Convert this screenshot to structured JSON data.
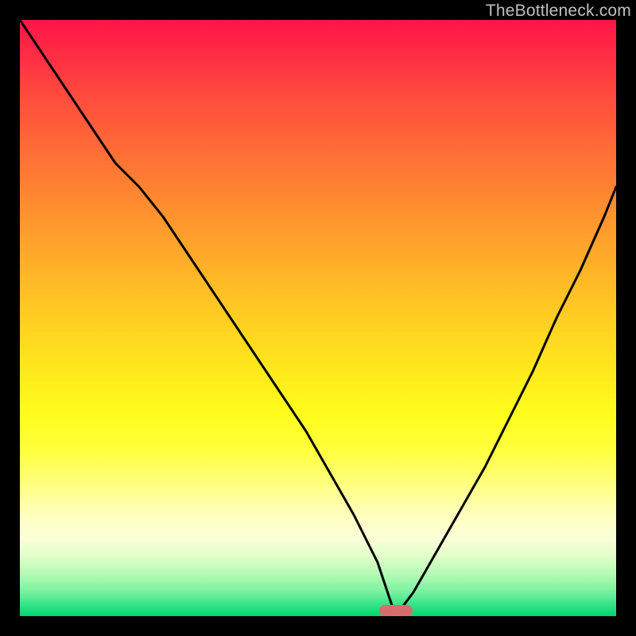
{
  "watermark": "TheBottleneck.com",
  "marker": {
    "x_pct": 63,
    "y_pct": 99,
    "color": "#d76e6e"
  },
  "chart_data": {
    "type": "line",
    "title": "",
    "xlabel": "",
    "ylabel": "",
    "xlim": [
      0,
      100
    ],
    "ylim": [
      0,
      100
    ],
    "grid": false,
    "legend": false,
    "background": "red-yellow-green vertical gradient",
    "annotations": [
      {
        "type": "pill",
        "x": 63,
        "y": 0,
        "color": "#d76e6e"
      }
    ],
    "series": [
      {
        "name": "bottleneck-curve",
        "color": "#000000",
        "x": [
          0,
          4,
          8,
          12,
          16,
          20,
          24,
          28,
          32,
          36,
          40,
          44,
          48,
          52,
          56,
          60,
          63,
          66,
          70,
          74,
          78,
          82,
          86,
          90,
          94,
          98,
          100
        ],
        "values": [
          100,
          94,
          88,
          82,
          76,
          72,
          67,
          61,
          55,
          49,
          43,
          37,
          31,
          24,
          17,
          9,
          0,
          4,
          11,
          18,
          25,
          33,
          41,
          50,
          58,
          67,
          72
        ]
      }
    ]
  }
}
